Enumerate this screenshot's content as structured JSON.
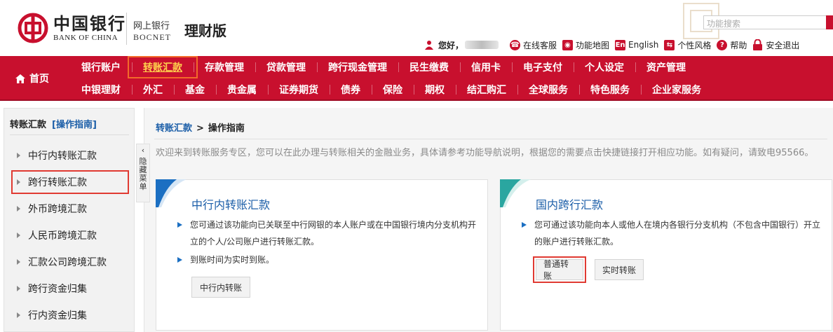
{
  "header": {
    "logo_cn": "中国银行",
    "logo_en": "BANK OF CHINA",
    "nb_cn": "网上银行",
    "nb_en": "BOCNET",
    "version": "理财版",
    "search_placeholder": "功能搜索",
    "greeting": "您好，",
    "links": [
      {
        "label": "在线客服",
        "icon": "headset-icon"
      },
      {
        "label": "功能地图",
        "icon": "map-pin-icon"
      },
      {
        "label": "English",
        "icon": "en-icon"
      },
      {
        "label": "个性风格",
        "icon": "swap-icon"
      },
      {
        "label": "帮助",
        "icon": "help-icon"
      },
      {
        "label": "安全退出",
        "icon": "lock-icon"
      }
    ]
  },
  "nav": {
    "home": "首页",
    "row1": [
      "银行账户",
      "转账汇款",
      "存款管理",
      "贷款管理",
      "跨行现金管理",
      "民生缴费",
      "信用卡",
      "电子支付",
      "个人设定",
      "资产管理"
    ],
    "row2": [
      "中银理财",
      "外汇",
      "基金",
      "贵金属",
      "证券期货",
      "债券",
      "保险",
      "期权",
      "结汇购汇",
      "全球服务",
      "特色服务",
      "企业家服务"
    ],
    "active": "转账汇款"
  },
  "sidebar": {
    "title": "转账汇款",
    "guide": "[操作指南]",
    "items": [
      "中行内转账汇款",
      "跨行转账汇款",
      "外币跨境汇款",
      "人民币跨境汇款",
      "汇款公司跨境汇款",
      "跨行资金归集",
      "行内资金归集"
    ],
    "selected": "跨行转账汇款",
    "collapse_label": "隐藏菜单",
    "collapse_arrow": "‹"
  },
  "main": {
    "crumb": [
      "转账汇款",
      ">",
      "操作指南"
    ],
    "intro": "欢迎来到转账服务专区，您可以在此办理与转账相关的金融业务，具体请参考功能导航说明，根据您的需要点击快捷链接打开相应功能。如有疑问，请致电95566。",
    "cards": [
      {
        "title": "中行内转账汇款",
        "bullets": [
          "您可通过该功能向已关联至中行网银的本人账户或在中国银行境内分支机构开立的个人/公司账户进行转账汇款。",
          "到账时间为实时到账。"
        ],
        "buttons": [
          "中行内转账"
        ]
      },
      {
        "title": "国内跨行汇款",
        "bullets": [
          "您可通过该功能向本人或他人在境内各银行分支机构（不包含中国银行）开立的账户进行转账汇款。"
        ],
        "buttons": [
          "普通转账",
          "实时转账"
        ]
      }
    ]
  },
  "colors": {
    "brand_red": "#c8102e",
    "link_blue": "#1b5ea8",
    "highlight_red": "#e03a32",
    "teal": "#2aa6a0"
  }
}
